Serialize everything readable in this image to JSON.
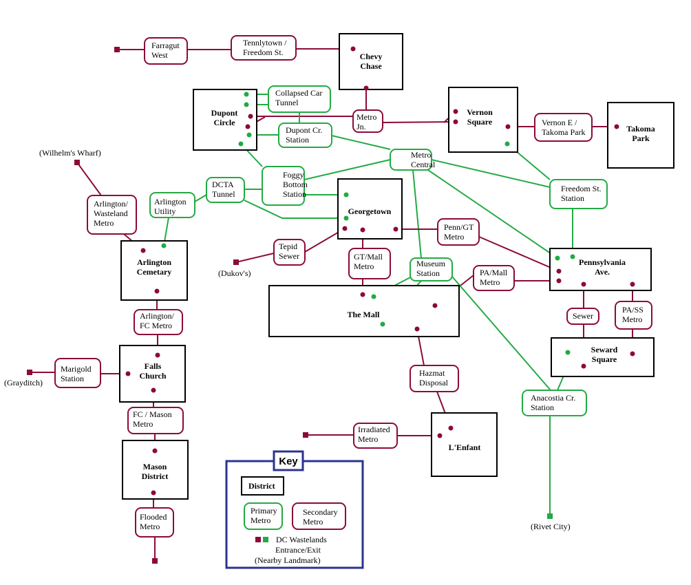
{
  "colors": {
    "primary": "#22aa44",
    "secondary": "#8b0a3a",
    "district": "#000000",
    "key_border": "#2b3390"
  },
  "districts": [
    {
      "id": "chevy-chase",
      "lines": [
        "Chevy",
        "Chase"
      ]
    },
    {
      "id": "dupont-circle",
      "lines": [
        "Dupont",
        "Circle"
      ]
    },
    {
      "id": "vernon-square",
      "lines": [
        "Vernon",
        "Square"
      ]
    },
    {
      "id": "takoma-park",
      "lines": [
        "Takoma",
        "Park"
      ]
    },
    {
      "id": "georgetown",
      "lines": [
        "Georgetown"
      ]
    },
    {
      "id": "arlington-cemetary",
      "lines": [
        "Arlington",
        "Cemetary"
      ]
    },
    {
      "id": "pennsylvania-ave",
      "lines": [
        "Pennsylvania",
        "Ave."
      ]
    },
    {
      "id": "the-mall",
      "lines": [
        "The Mall"
      ]
    },
    {
      "id": "seward-square",
      "lines": [
        "Seward",
        "Square"
      ]
    },
    {
      "id": "falls-church",
      "lines": [
        "Falls",
        "Church"
      ]
    },
    {
      "id": "lenfant",
      "lines": [
        "L'Enfant"
      ]
    },
    {
      "id": "mason-district",
      "lines": [
        "Mason",
        "District"
      ]
    }
  ],
  "primary_metros": [
    {
      "id": "collapsed-car-tunnel",
      "lines": [
        "Collapsed Car",
        "Tunnel"
      ]
    },
    {
      "id": "dupont-cr-station",
      "lines": [
        "Dupont Cr.",
        "Station"
      ]
    },
    {
      "id": "metro-central",
      "lines": [
        "Metro",
        "Central"
      ]
    },
    {
      "id": "foggy-bottom-station",
      "lines": [
        "Foggy",
        "Bottom",
        "Station"
      ]
    },
    {
      "id": "dcta-tunnel",
      "lines": [
        "DCTA",
        "Tunnel"
      ]
    },
    {
      "id": "arlington-utility",
      "lines": [
        "Arlington",
        "Utility"
      ]
    },
    {
      "id": "freedom-st-station",
      "lines": [
        "Freedom St.",
        "Station"
      ]
    },
    {
      "id": "museum-station",
      "lines": [
        "Museum",
        "Station"
      ]
    },
    {
      "id": "anacostia-cr-station",
      "lines": [
        "Anacostia Cr.",
        "Station"
      ]
    }
  ],
  "secondary_metros": [
    {
      "id": "farragut-west",
      "lines": [
        "Farragut",
        "West"
      ]
    },
    {
      "id": "tennlytown-freedom-st",
      "lines": [
        "Tennlytown /",
        "Freedom St."
      ]
    },
    {
      "id": "metro-jn",
      "lines": [
        "Metro",
        "Jn."
      ]
    },
    {
      "id": "vernon-e-takoma-park",
      "lines": [
        "Vernon E /",
        "Takoma Park"
      ]
    },
    {
      "id": "arlington-wasteland-metro",
      "lines": [
        "Arlington/",
        "Wasteland",
        "Metro"
      ]
    },
    {
      "id": "tepid-sewer",
      "lines": [
        "Tepid",
        "Sewer"
      ]
    },
    {
      "id": "gt-mall-metro",
      "lines": [
        "GT/Mall",
        "Metro"
      ]
    },
    {
      "id": "penn-gt-metro",
      "lines": [
        "Penn/GT",
        "Metro"
      ]
    },
    {
      "id": "pa-mall-metro",
      "lines": [
        "PA/Mall",
        "Metro"
      ]
    },
    {
      "id": "sewer",
      "lines": [
        "Sewer"
      ]
    },
    {
      "id": "pa-ss-metro",
      "lines": [
        "PA/SS",
        "Metro"
      ]
    },
    {
      "id": "arlington-fc-metro",
      "lines": [
        "Arlington/",
        "FC Metro"
      ]
    },
    {
      "id": "marigold-station",
      "lines": [
        "Marigold",
        "Station"
      ]
    },
    {
      "id": "fc-mason-metro",
      "lines": [
        "FC / Mason",
        "Metro"
      ]
    },
    {
      "id": "hazmat-disposal",
      "lines": [
        "Hazmat",
        "Disposal"
      ]
    },
    {
      "id": "irradiated-metro",
      "lines": [
        "Irradiated",
        "Metro"
      ]
    },
    {
      "id": "flooded-metro",
      "lines": [
        "Flooded",
        "Metro"
      ]
    }
  ],
  "landmarks": [
    {
      "id": "wilhelms-wharf",
      "text": "(Wilhelm's Wharf)"
    },
    {
      "id": "dukovs",
      "text": "(Dukov's)"
    },
    {
      "id": "grayditch",
      "text": "(Grayditch)"
    },
    {
      "id": "rivet-city",
      "text": "(Rivet City)"
    }
  ],
  "key": {
    "title": "Key",
    "district_label": "District",
    "primary_label": [
      "Primary",
      "Metro"
    ],
    "secondary_label": [
      "Secondary",
      "Metro"
    ],
    "exit_label": [
      "DC Wastelands",
      "Entrance/Exit",
      "(Nearby Landmark)"
    ]
  }
}
